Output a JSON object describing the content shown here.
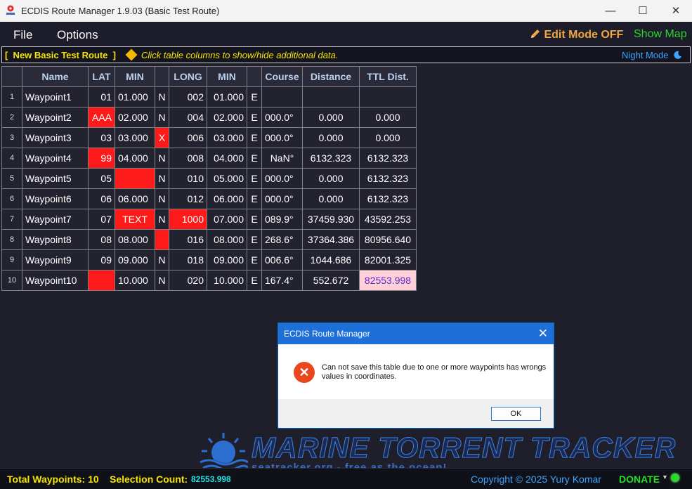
{
  "window": {
    "title": "ECDIS Route Manager 1.9.03 (Basic Test Route)"
  },
  "menu": {
    "file": "File",
    "options": "Options",
    "edit_mode": "Edit Mode OFF",
    "edit_icon": "pencil-icon",
    "show_map": "Show Map"
  },
  "infobar": {
    "route_name": "[  New Basic Test Route  ]",
    "hint": "Click table columns to show/hide additional data.",
    "night_mode": "Night Mode",
    "night_icon": "moon-icon"
  },
  "table": {
    "headers": [
      "",
      "Name",
      "LAT",
      "MIN",
      "",
      "LONG",
      "MIN",
      "",
      "Course",
      "Distance",
      "TTL Dist."
    ],
    "rows": [
      {
        "n": "1",
        "name": "Waypoint1",
        "lat": "01",
        "lat_min": "01.000",
        "ns": "N",
        "long": "002",
        "long_min": "01.000",
        "ew": "E",
        "course": "",
        "dist": "",
        "ttl": ""
      },
      {
        "n": "2",
        "name": "Waypoint2",
        "lat": "AAA",
        "lat_min": "02.000",
        "ns": "N",
        "long": "004",
        "long_min": "02.000",
        "ew": "E",
        "course": "000.0°",
        "dist": "0.000",
        "ttl": "0.000"
      },
      {
        "n": "3",
        "name": "Waypoint3",
        "lat": "03",
        "lat_min": "03.000",
        "ns": "X",
        "long": "006",
        "long_min": "03.000",
        "ew": "E",
        "course": "000.0°",
        "dist": "0.000",
        "ttl": "0.000"
      },
      {
        "n": "4",
        "name": "Waypoint4",
        "lat": "99",
        "lat_min": "04.000",
        "ns": "N",
        "long": "008",
        "long_min": "04.000",
        "ew": "E",
        "course": "NaN°",
        "dist": "6132.323",
        "ttl": "6132.323"
      },
      {
        "n": "5",
        "name": "Waypoint5",
        "lat": "05",
        "lat_min": "",
        "ns": "N",
        "long": "010",
        "long_min": "05.000",
        "ew": "E",
        "course": "000.0°",
        "dist": "0.000",
        "ttl": "6132.323"
      },
      {
        "n": "6",
        "name": "Waypoint6",
        "lat": "06",
        "lat_min": "06.000",
        "ns": "N",
        "long": "012",
        "long_min": "06.000",
        "ew": "E",
        "course": "000.0°",
        "dist": "0.000",
        "ttl": "6132.323"
      },
      {
        "n": "7",
        "name": "Waypoint7",
        "lat": "07",
        "lat_min": "TEXT",
        "ns": "N",
        "long": "1000",
        "long_min": "07.000",
        "ew": "E",
        "course": "089.9°",
        "dist": "37459.930",
        "ttl": "43592.253"
      },
      {
        "n": "8",
        "name": "Waypoint8",
        "lat": "08",
        "lat_min": "08.000",
        "ns": "",
        "long": "016",
        "long_min": "08.000",
        "ew": "E",
        "course": "268.6°",
        "dist": "37364.386",
        "ttl": "80956.640"
      },
      {
        "n": "9",
        "name": "Waypoint9",
        "lat": "09",
        "lat_min": "09.000",
        "ns": "N",
        "long": "018",
        "long_min": "09.000",
        "ew": "E",
        "course": "006.6°",
        "dist": "1044.686",
        "ttl": "82001.325"
      },
      {
        "n": "10",
        "name": "Waypoint10",
        "lat": "",
        "lat_min": "10.000",
        "ns": "N",
        "long": "020",
        "long_min": "10.000",
        "ew": "E",
        "course": "167.4°",
        "dist": "552.672",
        "ttl": "82553.998"
      }
    ]
  },
  "dialog": {
    "title": "ECDIS Route Manager",
    "message": "Can not save this table due to one or more waypoints has wrongs values in coordinates.",
    "ok": "OK",
    "close": "✕",
    "icon": "error-icon"
  },
  "watermark": {
    "title": "MARINE TORRENT TRACKER",
    "subtitle": "seatracker.org - free as the ocean!"
  },
  "status": {
    "total": "Total Waypoints: 10",
    "selection_label": "Selection Count:",
    "selection_value": "82553.998",
    "copyright": "Copyright © 2025 Yury Komar",
    "donate": "DONATE"
  },
  "colors": {
    "error": "#ff1a1a",
    "highlight": "#ffd0d8",
    "accent_yellow": "#f5e500",
    "edit_orange": "#f2a640",
    "show_map_green": "#2ed02e",
    "night_blue": "#3aa6ff"
  }
}
